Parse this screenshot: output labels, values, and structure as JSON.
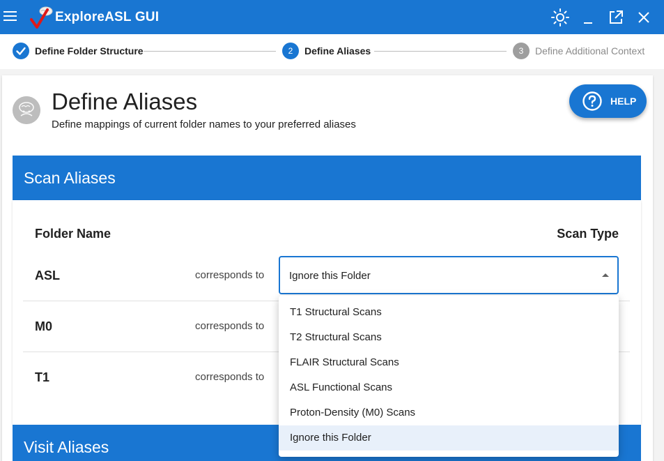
{
  "app": {
    "title": "ExploreASL GUI",
    "colors": {
      "primary": "#1976d2",
      "inactive_step": "#9e9e9e"
    },
    "actions": [
      "theme-toggle-icon",
      "minimize-icon",
      "open-external-icon",
      "close-icon"
    ]
  },
  "stepper": {
    "steps": [
      {
        "label": "Define Folder Structure",
        "number": "1",
        "state": "completed"
      },
      {
        "label": "Define Aliases",
        "number": "2",
        "state": "active"
      },
      {
        "label": "Define Additional Context",
        "number": "3",
        "state": "inactive"
      }
    ]
  },
  "page": {
    "title": "Define Aliases",
    "subtitle": "Define mappings of current folder names to your preferred aliases",
    "help_label": "HELP"
  },
  "scan_aliases": {
    "title": "Scan Aliases",
    "col_folder": "Folder Name",
    "col_scan_type": "Scan Type",
    "rows": [
      {
        "folder": "ASL",
        "corresponds": "corresponds to",
        "value": "Ignore this Folder"
      },
      {
        "folder": "M0",
        "corresponds": "corresponds to"
      },
      {
        "folder": "T1",
        "corresponds": "corresponds to"
      }
    ]
  },
  "dropdown": {
    "options": [
      "T1 Structural Scans",
      "T2 Structural Scans",
      "FLAIR Structural Scans",
      "ASL Functional Scans",
      "Proton-Density (M0) Scans",
      "Ignore this Folder"
    ],
    "selected": "Ignore this Folder"
  },
  "visit_aliases": {
    "title": "Visit Aliases"
  }
}
